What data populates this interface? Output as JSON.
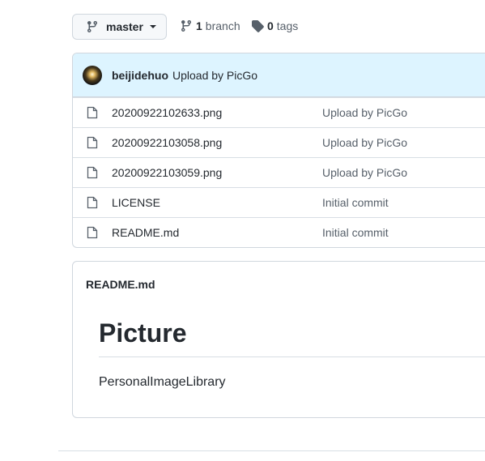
{
  "branch_selector": {
    "label": "master"
  },
  "branches": {
    "count": "1",
    "label": "branch"
  },
  "tags": {
    "count": "0",
    "label": "tags"
  },
  "latest_commit": {
    "author": "beijidehuo",
    "message": "Upload by PicGo"
  },
  "files": [
    {
      "name": "20200922102633.png",
      "commit": "Upload by PicGo"
    },
    {
      "name": "20200922103058.png",
      "commit": "Upload by PicGo"
    },
    {
      "name": "20200922103059.png",
      "commit": "Upload by PicGo"
    },
    {
      "name": "LICENSE",
      "commit": "Initial commit"
    },
    {
      "name": "README.md",
      "commit": "Initial commit"
    }
  ],
  "readme": {
    "file_label": "README.md",
    "heading": "Picture",
    "body": "PersonalImageLibrary"
  }
}
